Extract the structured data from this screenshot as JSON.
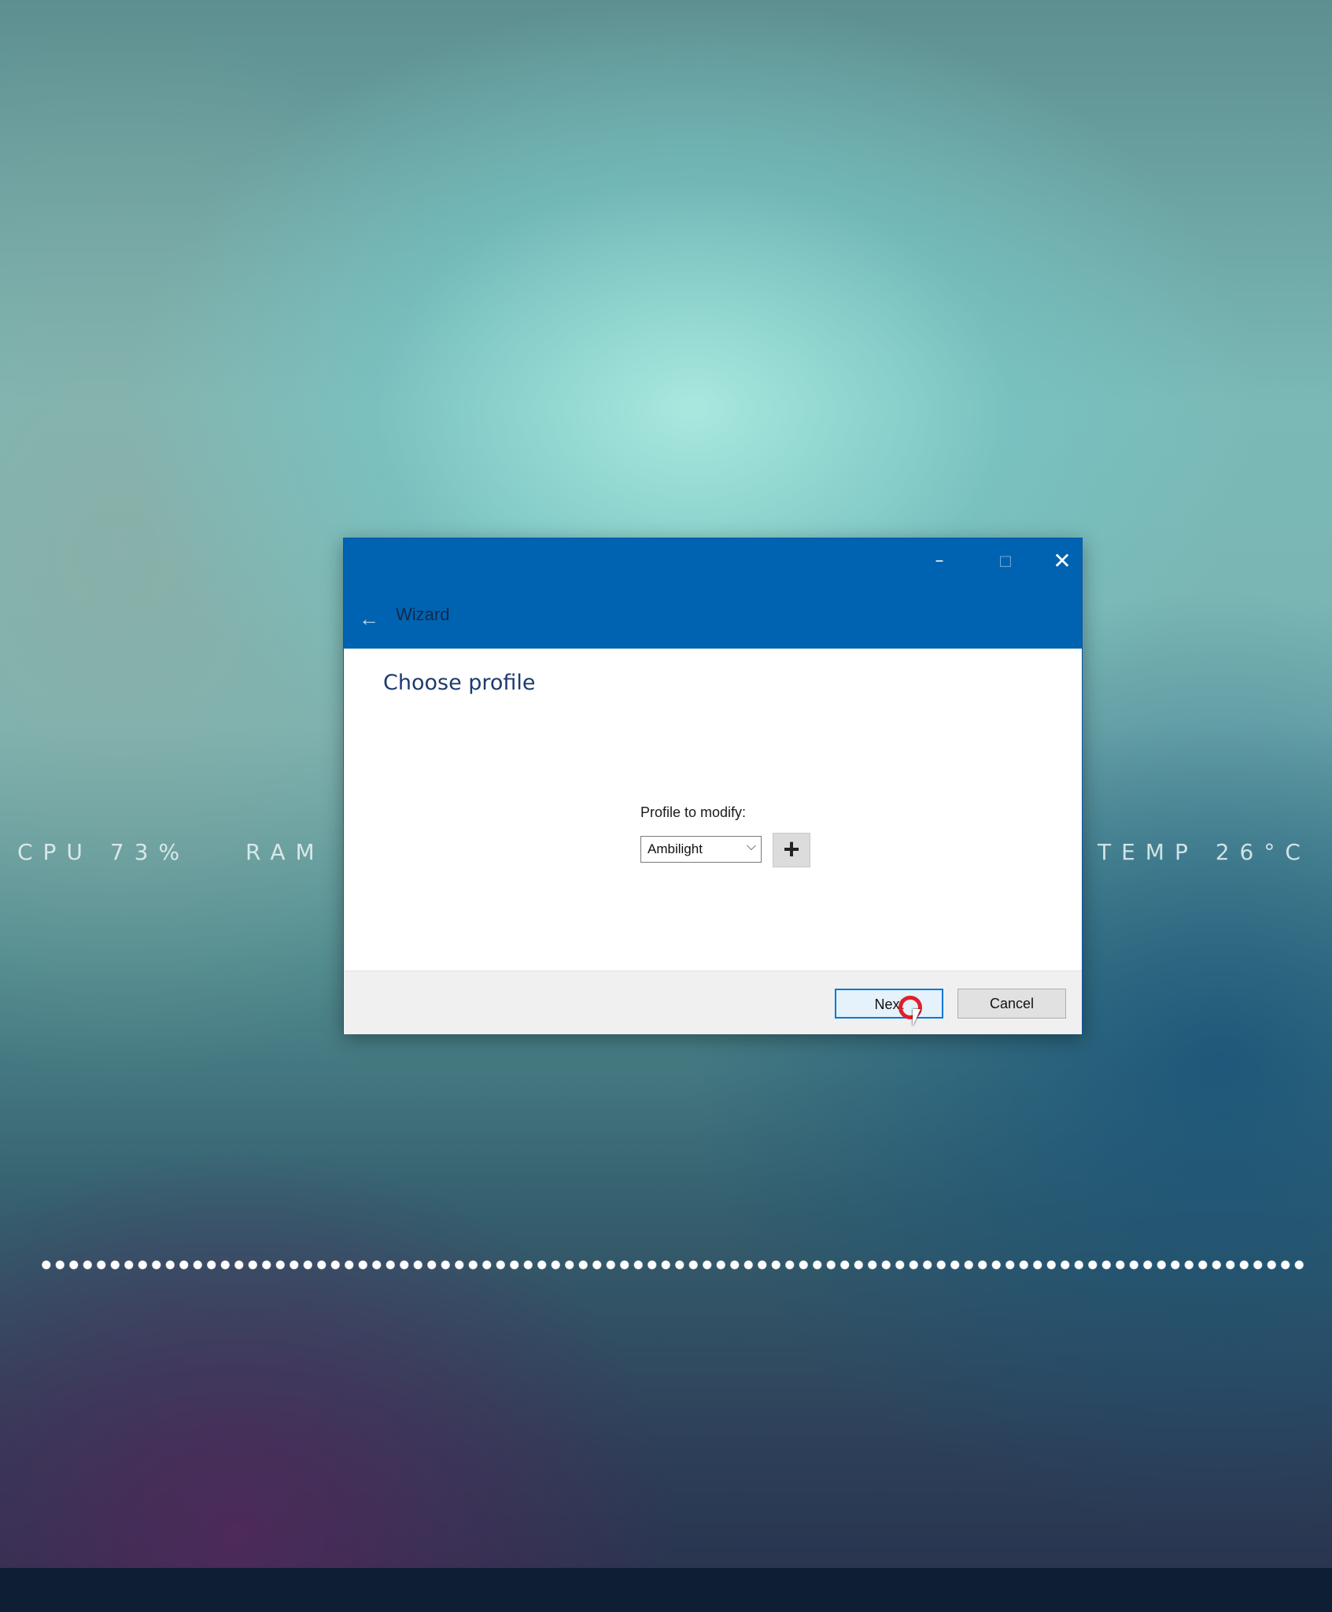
{
  "desktop": {
    "stats": {
      "cpu": "CPU 73%",
      "ram": "RAM",
      "temp": "TEMP 26°C"
    }
  },
  "dialog": {
    "title": "Wizard",
    "heading": "Choose profile",
    "window_buttons": {
      "minimize": "–",
      "maximize": "□",
      "close": "✕"
    },
    "back_icon": "←",
    "profile_field": {
      "label": "Profile to modify:",
      "value": "Ambilight",
      "arrow": "⌵"
    },
    "add_icon": "+",
    "buttons": {
      "next": "Next",
      "cancel": "Cancel"
    }
  },
  "colors": {
    "titlebar": "#0063b1",
    "accent": "#0078d7",
    "click_marker": "#e0202a"
  }
}
